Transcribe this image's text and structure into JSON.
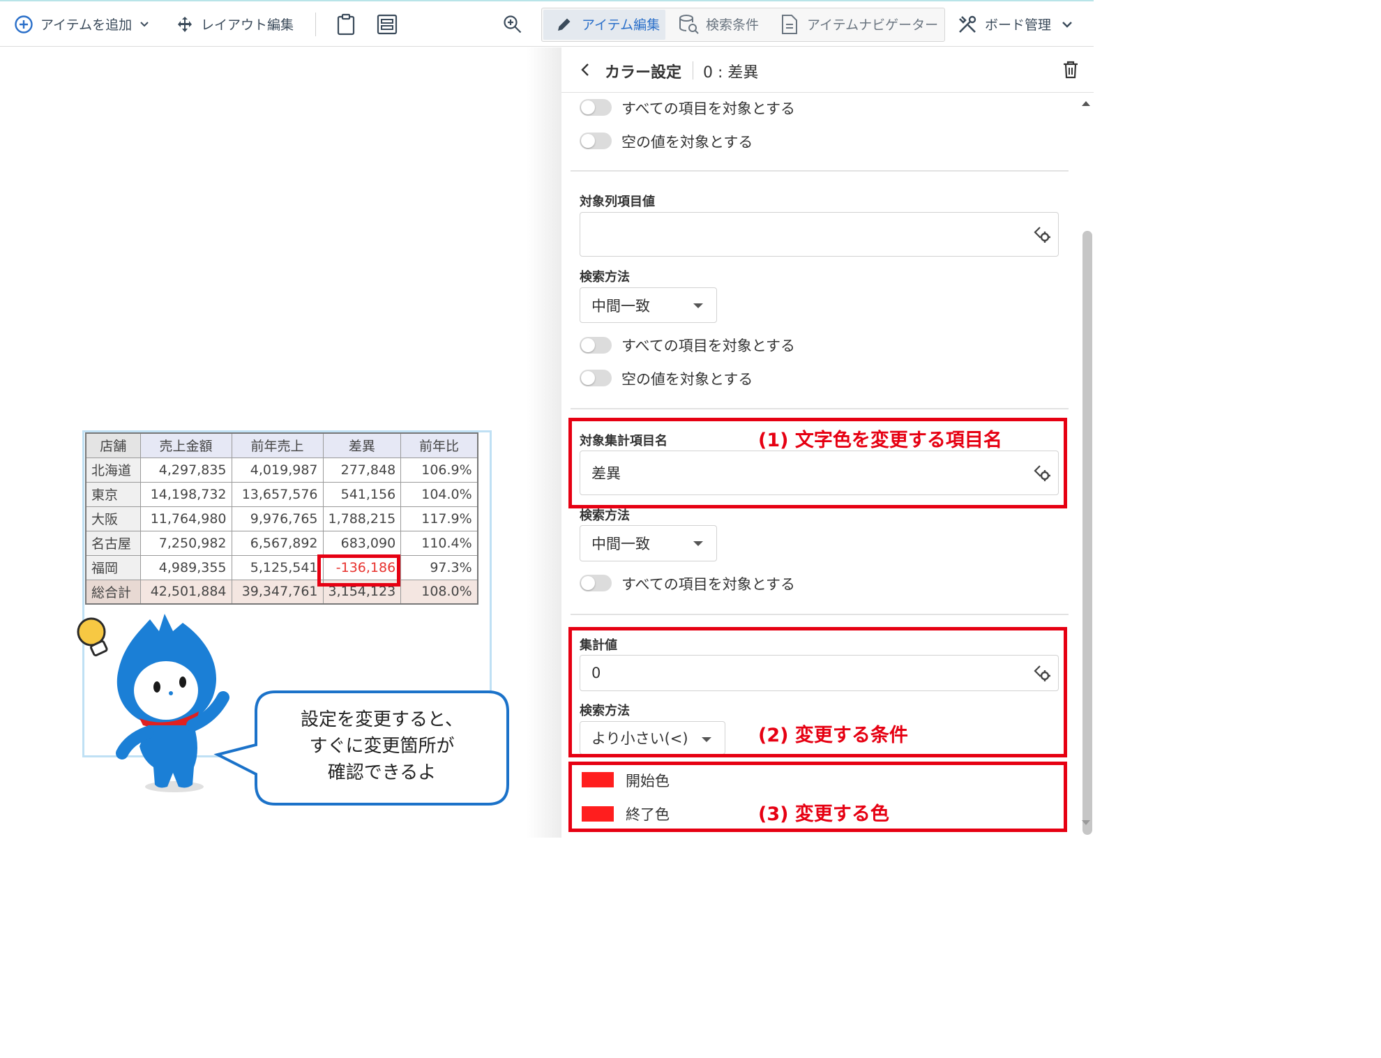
{
  "toolbar": {
    "add_item": "アイテムを追加",
    "layout_edit": "レイアウト編集",
    "item_edit": "アイテム編集",
    "search_cond": "検索条件",
    "item_navigator": "アイテムナビゲーター",
    "board_manage": "ボード管理"
  },
  "table": {
    "headers": [
      "店舗",
      "売上金額",
      "前年売上",
      "差異",
      "前年比"
    ],
    "rows": [
      [
        "北海道",
        "4,297,835",
        "4,019,987",
        "277,848",
        "106.9%"
      ],
      [
        "東京",
        "14,198,732",
        "13,657,576",
        "541,156",
        "104.0%"
      ],
      [
        "大阪",
        "11,764,980",
        "9,976,765",
        "1,788,215",
        "117.9%"
      ],
      [
        "名古屋",
        "7,250,982",
        "6,567,892",
        "683,090",
        "110.4%"
      ],
      [
        "福岡",
        "4,989,355",
        "5,125,541",
        "-136,186",
        "97.3%"
      ],
      [
        "総合計",
        "42,501,884",
        "39,347,761",
        "3,154,123",
        "108.0%"
      ]
    ]
  },
  "bubble": {
    "line1": "設定を変更すると、",
    "line2": "すぐに変更箇所が",
    "line3": "確認できるよ"
  },
  "panel": {
    "title": "カラー設定",
    "subtitle": "0 : 差異",
    "toggle_all": "すべての項目を対象とする",
    "toggle_empty": "空の値を対象とする",
    "target_col_label": "対象列項目値",
    "target_col_value": "",
    "search_method_label": "検索方法",
    "match_middle": "中間一致",
    "target_agg_label": "対象集計項目名",
    "target_agg_value": "差異",
    "agg_value_label": "集計値",
    "agg_value": "0",
    "less_than": "より小さい(<)",
    "start_color": "開始色",
    "end_color": "終了色"
  },
  "annotations": {
    "a1": "(1) 文字色を変更する項目名",
    "a2": "(2) 変更する条件",
    "a3": "(3) 変更する色"
  },
  "colors": {
    "accent": "#1d7ad0",
    "highlight": "#e60012",
    "swatch": "#ff1e1e",
    "negative_text": "#e8322e"
  }
}
